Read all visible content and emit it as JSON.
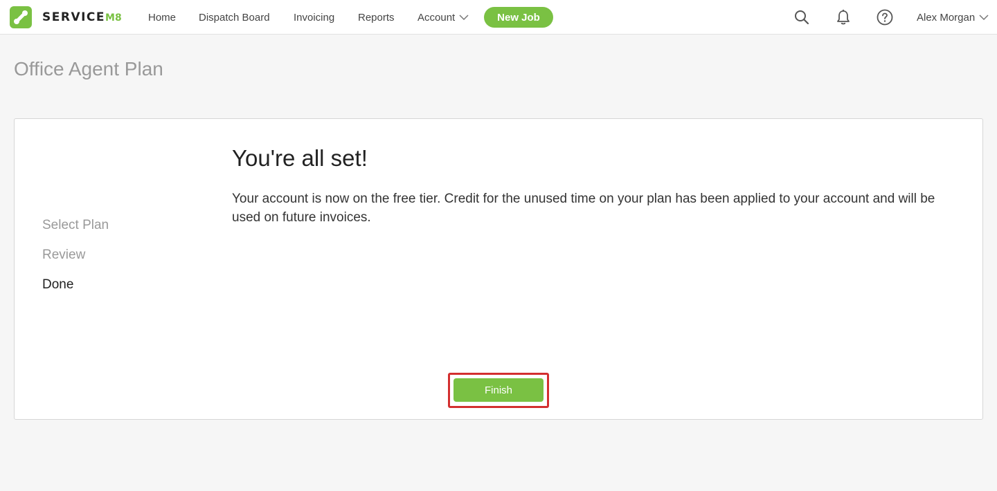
{
  "brand": {
    "name": "SERVICE",
    "suffix": "M8",
    "accent_color": "#7ac143",
    "logo_icon": "servicem8-logo-icon"
  },
  "nav": {
    "items": [
      {
        "label": "Home"
      },
      {
        "label": "Dispatch Board"
      },
      {
        "label": "Invoicing"
      },
      {
        "label": "Reports"
      },
      {
        "label": "Account",
        "icon": "chevron-down-icon"
      }
    ],
    "new_job_label": "New Job",
    "icons": [
      "search-icon",
      "bell-icon",
      "help-icon"
    ],
    "user_name": "Alex Morgan"
  },
  "page": {
    "title": "Office Agent Plan"
  },
  "wizard": {
    "steps": [
      {
        "label": "Select Plan",
        "active": false
      },
      {
        "label": "Review",
        "active": false
      },
      {
        "label": "Done",
        "active": true
      }
    ],
    "heading": "You're all set!",
    "message": "Your account is now on the free tier. Credit for the unused time on your plan has been applied to your account and will be used on future invoices.",
    "finish_label": "Finish",
    "highlight_color": "#d32f2f"
  }
}
